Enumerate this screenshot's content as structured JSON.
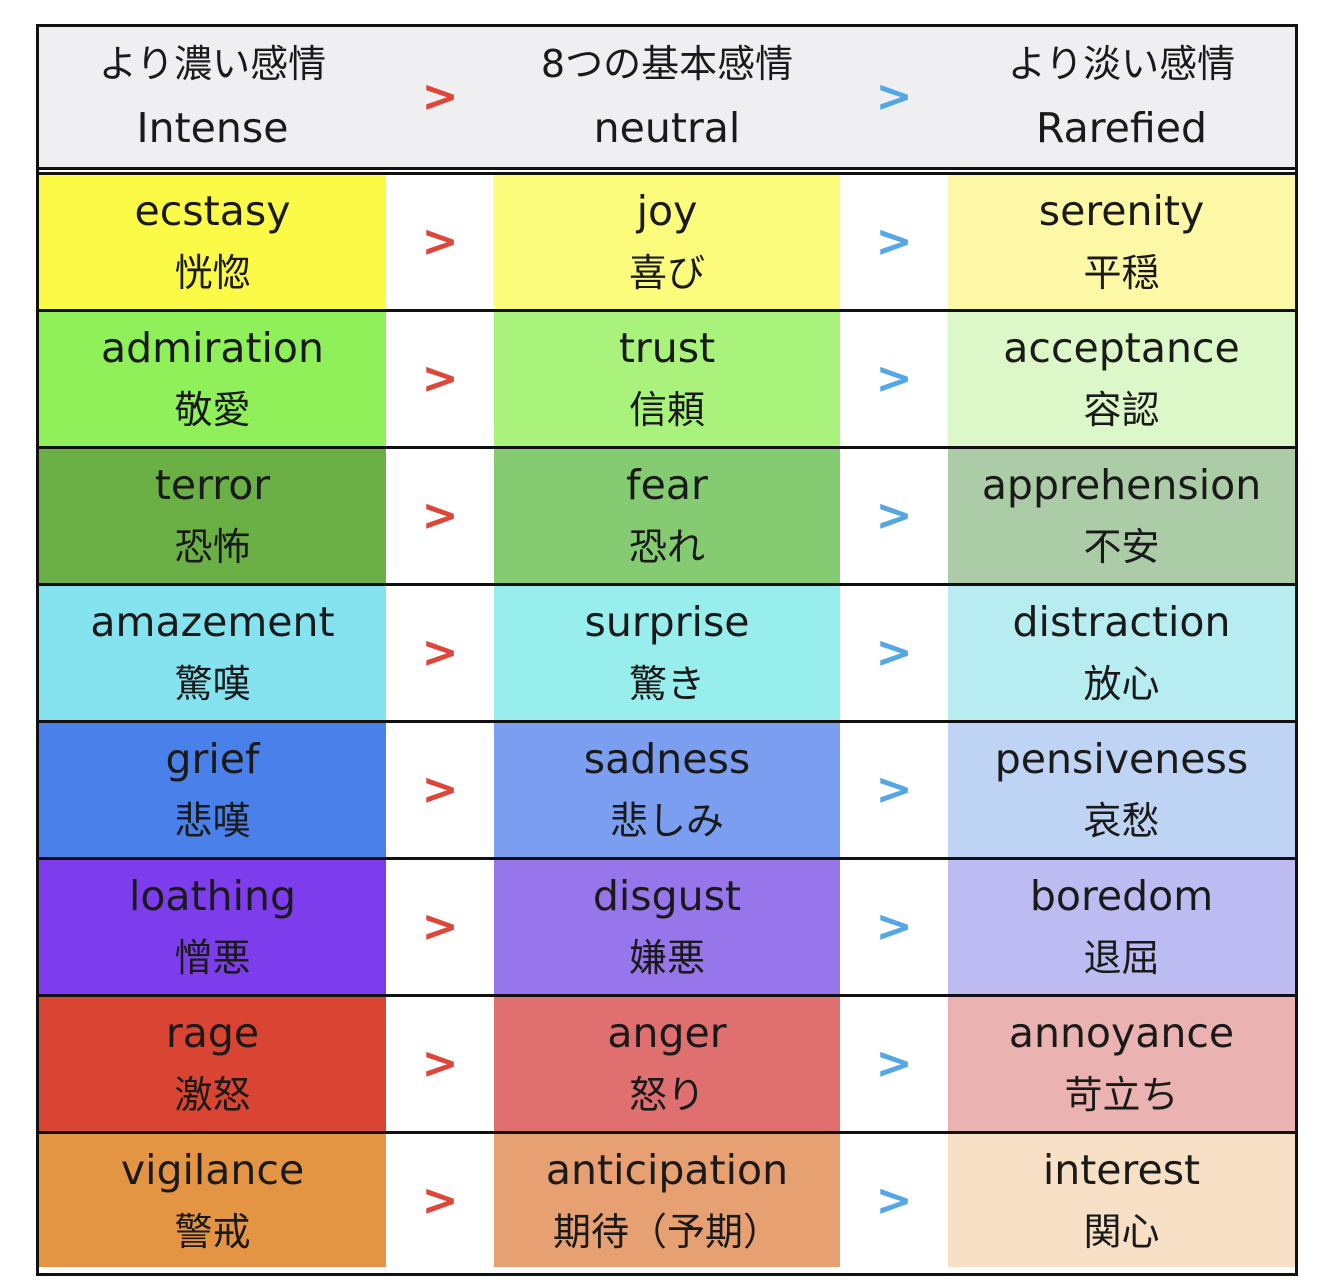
{
  "header": {
    "intense": {
      "ja": "より濃い感情",
      "en": "Intense"
    },
    "neutral": {
      "ja": "8つの基本感情",
      "en": "neutral"
    },
    "rarefied": {
      "ja": "より淡い感情",
      "en": "Rarefied"
    },
    "arrow_red": ">",
    "arrow_blue": ">"
  },
  "rows": [
    {
      "intense": {
        "en": "ecstasy",
        "ja": "恍惚",
        "color": "#fbfb47"
      },
      "neutral": {
        "en": "joy",
        "ja": "喜び",
        "color": "#fbfb7c"
      },
      "rarefied": {
        "en": "serenity",
        "ja": "平穏",
        "color": "#fcf8a6"
      }
    },
    {
      "intense": {
        "en": "admiration",
        "ja": "敬愛",
        "color": "#8ff059"
      },
      "neutral": {
        "en": "trust",
        "ja": "信頼",
        "color": "#a9f27c"
      },
      "rarefied": {
        "en": "acceptance",
        "ja": "容認",
        "color": "#dcf8c8"
      }
    },
    {
      "intense": {
        "en": "terror",
        "ja": "恐怖",
        "color": "#6ab045"
      },
      "neutral": {
        "en": "fear",
        "ja": "恐れ",
        "color": "#84cb72"
      },
      "rarefied": {
        "en": "apprehension",
        "ja": "不安",
        "color": "#abcca6"
      }
    },
    {
      "intense": {
        "en": "amazement",
        "ja": "驚嘆",
        "color": "#85e3f0"
      },
      "neutral": {
        "en": "surprise",
        "ja": "驚き",
        "color": "#98eeec"
      },
      "rarefied": {
        "en": "distraction",
        "ja": "放心",
        "color": "#b7ecf0"
      }
    },
    {
      "intense": {
        "en": "grief",
        "ja": "悲嘆",
        "color": "#4a80ea"
      },
      "neutral": {
        "en": "sadness",
        "ja": "悲しみ",
        "color": "#7b9ef0"
      },
      "rarefied": {
        "en": "pensiveness",
        "ja": "哀愁",
        "color": "#bfd3f5"
      }
    },
    {
      "intense": {
        "en": "loathing",
        "ja": "憎悪",
        "color": "#7d3ded"
      },
      "neutral": {
        "en": "disgust",
        "ja": "嫌悪",
        "color": "#9775ea"
      },
      "rarefied": {
        "en": "boredom",
        "ja": "退屈",
        "color": "#bdbcf2"
      }
    },
    {
      "intense": {
        "en": "rage",
        "ja": "激怒",
        "color": "#da4432"
      },
      "neutral": {
        "en": "anger",
        "ja": "怒り",
        "color": "#e07070"
      },
      "rarefied": {
        "en": "annoyance",
        "ja": "苛立ち",
        "color": "#ebb2b2"
      }
    },
    {
      "intense": {
        "en": "vigilance",
        "ja": "警戒",
        "color": "#e49543"
      },
      "neutral": {
        "en": "anticipation",
        "ja": "期待（予期）",
        "color": "#e6a072"
      },
      "rarefied": {
        "en": "interest",
        "ja": "関心",
        "color": "#f8e0c6"
      }
    }
  ]
}
